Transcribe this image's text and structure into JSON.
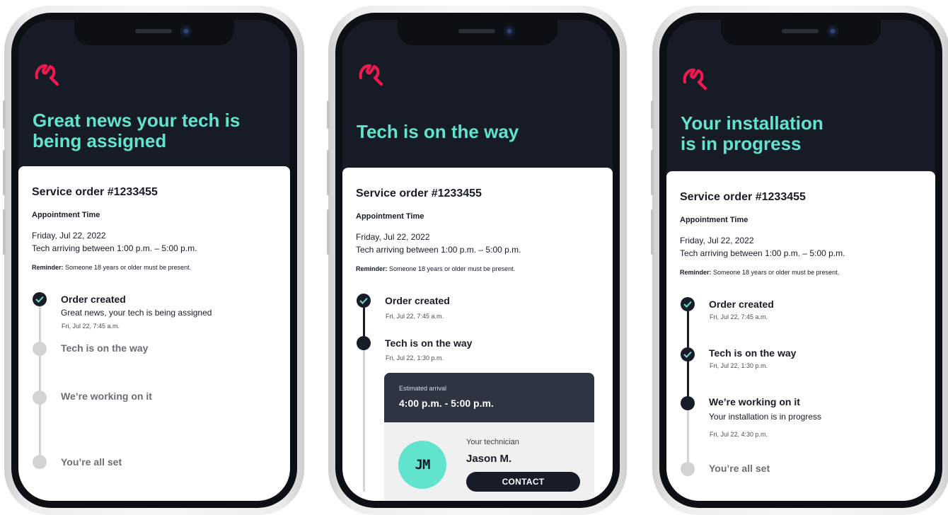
{
  "brand": {
    "accent_color": "#62e3cd",
    "logo_color": "#f0194f",
    "header_bg": "#161b26",
    "dark_color": "#171c28",
    "logo_icon": "wrench-icon"
  },
  "order": {
    "title": "Service order #1233455",
    "appointment_label": "Appointment Time",
    "date": "Friday, Jul 22, 2022",
    "window": "Tech arriving between 1:00 p.m. – 5:00 p.m.",
    "reminder_label": "Reminder:",
    "reminder_text": " Someone 18 years or older must be present."
  },
  "screens": [
    {
      "headline_line1": "Great news your tech is",
      "headline_line2": "being assigned",
      "steps": [
        {
          "title": "Order created",
          "description": "Great news, your tech is being assigned",
          "time": "Fri, Jul 22, 7:45 a.m.",
          "status": "done"
        },
        {
          "title": "Tech is on the way",
          "status": "pending"
        },
        {
          "title": "We’re working on it",
          "status": "pending"
        },
        {
          "title": "You’re all set",
          "status": "pending"
        }
      ]
    },
    {
      "headline_line1": "Tech is on the way",
      "steps": [
        {
          "title": "Order created",
          "time": "Fri, Jul 22, 7:45 a.m.",
          "status": "done"
        },
        {
          "title": "Tech is on the way",
          "time": "Fri, Jul 22, 1:30 p.m.",
          "status": "active"
        }
      ],
      "estimated_arrival_label": "Estimated arrival",
      "estimated_arrival_value": "4:00 p.m. - 5:00 p.m.",
      "technician_label": "Your technician",
      "technician_name": "Jason M.",
      "technician_initials": "JM",
      "contact_label": "CONTACT"
    },
    {
      "headline_line1": "Your installation",
      "headline_line2": "is in progress",
      "steps": [
        {
          "title": "Order created",
          "time": "Fri, Jul 22, 7:45 a.m.",
          "status": "done"
        },
        {
          "title": "Tech is on the way",
          "time": "Fri, Jul 22, 1:30 p.m.",
          "status": "done"
        },
        {
          "title": "We’re working on it",
          "description": "Your installation is in progress",
          "time": "Fri, Jul 22, 4:30 p.m.",
          "status": "active"
        },
        {
          "title": "You’re all set",
          "status": "pending"
        }
      ]
    }
  ]
}
